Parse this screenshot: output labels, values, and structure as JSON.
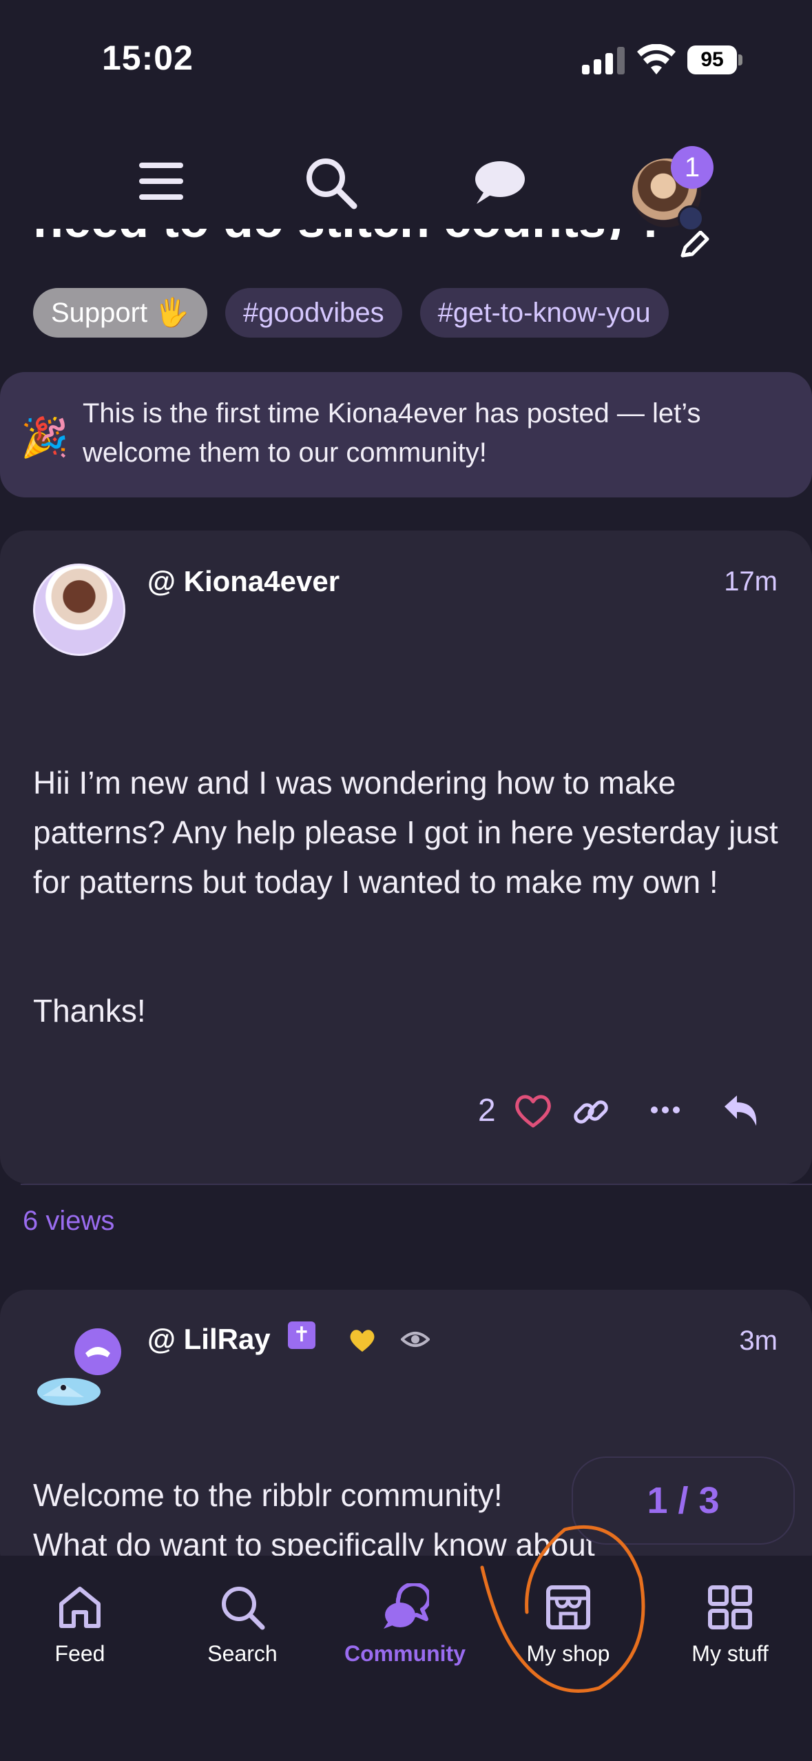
{
  "status_bar": {
    "time": "15:02",
    "battery": "95"
  },
  "top_nav": {
    "notification_count": "1"
  },
  "post": {
    "title_partial": "need to do stitch counts) ?",
    "tags": [
      "Support 🖐",
      "#goodvibes",
      "#get-to-know-you"
    ],
    "welcome_banner": "This is the first time Kiona4ever has posted — let’s welcome them to our community!",
    "author": "@ Kiona4ever",
    "time": "17m",
    "body": "Hii I’m new and I was wondering how to make patterns? Any help please I got in here yesterday just for patterns but today I wanted to make my own !",
    "thanks": "Thanks!",
    "like_count": "2",
    "views": "6 views"
  },
  "reply": {
    "author": "@ LilRay",
    "badge": "✝",
    "time": "3m",
    "body_line1": "Welcome to the ribblr community!",
    "body_line2": "What do want to specifically know about"
  },
  "pagination": "1 / 3",
  "bottom_nav": {
    "tabs": [
      {
        "label": "Feed",
        "icon": "home-icon"
      },
      {
        "label": "Search",
        "icon": "search-icon"
      },
      {
        "label": "Community",
        "icon": "community-icon"
      },
      {
        "label": "My shop",
        "icon": "shop-icon"
      },
      {
        "label": "My stuff",
        "icon": "grid-icon"
      }
    ],
    "active": "Community"
  },
  "colors": {
    "background": "#1e1c2b",
    "card": "#2a2738",
    "accent": "#9a6cf0",
    "heart": "#e0507a",
    "annotation": "#e8701e"
  }
}
